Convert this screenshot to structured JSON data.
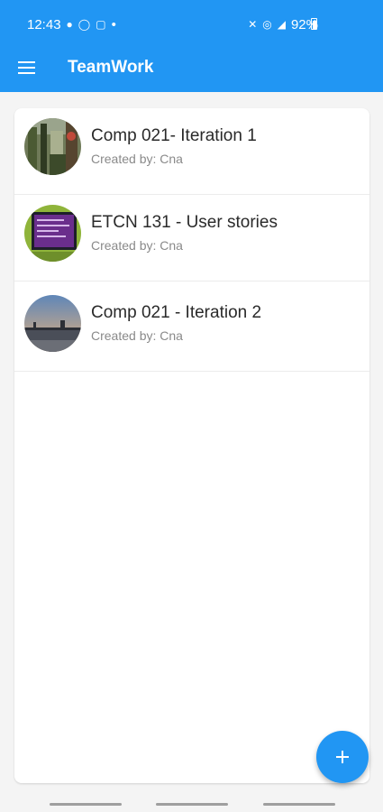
{
  "status_bar": {
    "time": "12:43",
    "dot": "•",
    "battery": "92%",
    "left_icons": [
      "snapchat-icon",
      "whatsapp-icon",
      "instagram-icon"
    ],
    "right_icons": [
      "mute-icon",
      "wifi-icon",
      "signal-icon",
      "battery-icon"
    ]
  },
  "app_bar": {
    "title": "TeamWork",
    "menu_icon": "hamburger-menu-icon"
  },
  "projects": [
    {
      "title": "Comp 021- Iteration 1",
      "created_by": "Created by: Cna",
      "thumbnail": "photo-greenhouse"
    },
    {
      "title": "ETCN 131 - User stories",
      "created_by": "Created by: Cna",
      "thumbnail": "photo-monitor-screen"
    },
    {
      "title": "Comp 021 - Iteration 2",
      "created_by": "Created by: Cna",
      "thumbnail": "photo-sunset-waterfront"
    }
  ],
  "fab": {
    "icon": "plus-icon"
  },
  "colors": {
    "primary": "#2196f3",
    "background": "#f4f4f4",
    "card": "#ffffff",
    "title_text": "#2a2a2a",
    "subtitle_text": "#8a8a8a"
  }
}
